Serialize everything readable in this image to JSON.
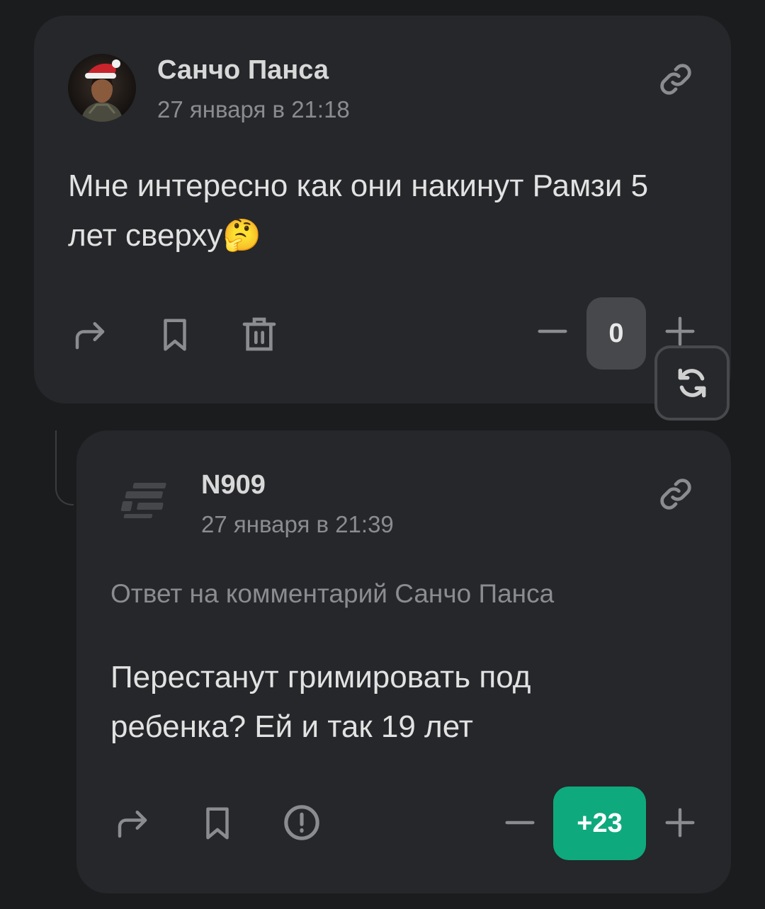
{
  "comments": [
    {
      "author": "Санчо Панса",
      "date": "27 января в 21:18",
      "text": "Мне интересно как они накинут Рамзи 5 лет сверху",
      "emoji": "🤔",
      "score": "0",
      "score_state": "neutral",
      "avatar": "santa-hat-avatar",
      "actions": [
        "share-icon",
        "bookmark-icon",
        "delete-icon"
      ]
    },
    {
      "author": "N909",
      "date": "27 января в 21:39",
      "reply_to": "Ответ на комментарий Санчо Панса",
      "text": "Перестанут гримировать под ребенка? Ей и так 19 лет",
      "score": "+23",
      "score_state": "positive",
      "avatar": "site-logo-avatar",
      "actions": [
        "share-icon",
        "bookmark-icon",
        "report-icon"
      ]
    }
  ],
  "colors": {
    "background": "#1b1c1e",
    "card": "#25272a",
    "positive": "#0fa97e",
    "neutral_score": "#46484c",
    "muted_text": "#8a8c90"
  }
}
